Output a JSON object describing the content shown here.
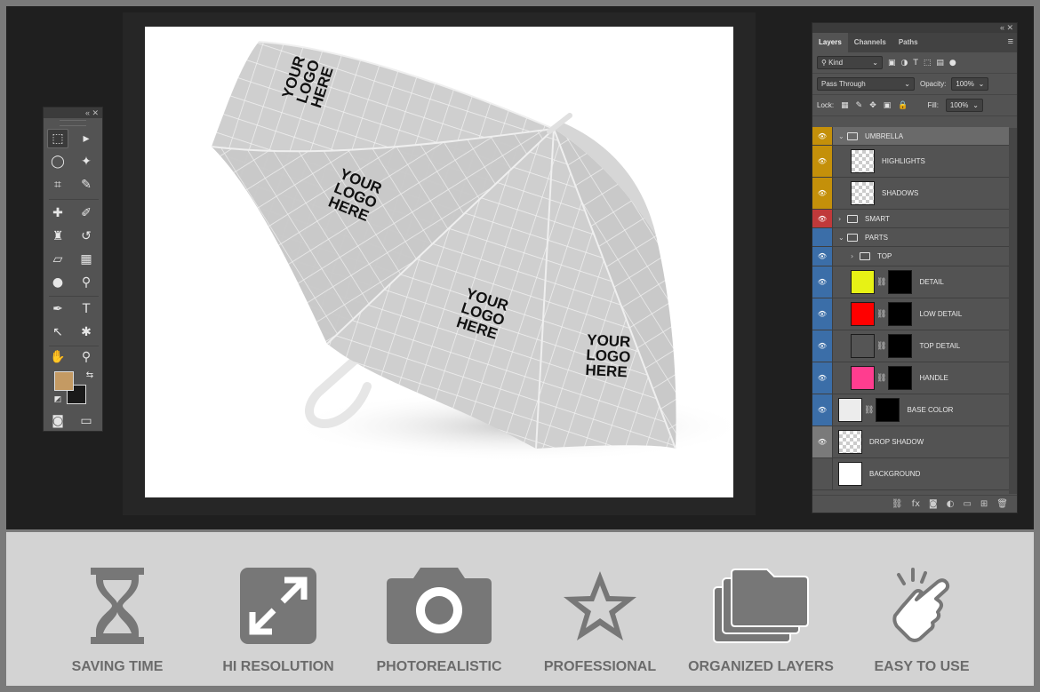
{
  "panels": {
    "tools_title_icons": "«  ✕",
    "layers_title_icons": "«  ✕"
  },
  "layers_panel": {
    "tabs": [
      "Layers",
      "Channels",
      "Paths"
    ],
    "filter_kind": "Kind",
    "blend_mode": "Pass Through",
    "opacity_label": "Opacity:",
    "opacity_value": "100%",
    "lock_label": "Lock:",
    "fill_label": "Fill:",
    "fill_value": "100%",
    "layers": [
      {
        "name": "UMBRELLA",
        "kind": "group",
        "open": true,
        "color": "#c4900a"
      },
      {
        "name": "HIGHLIGHTS",
        "kind": "layer",
        "color": "#c4900a"
      },
      {
        "name": "SHADOWS",
        "kind": "layer",
        "color": "#c4900a"
      },
      {
        "name": "SMART",
        "kind": "group",
        "open": false,
        "color": "#c0393a"
      },
      {
        "name": "PARTS",
        "kind": "group",
        "open": true,
        "color": "#3b6ea8"
      },
      {
        "name": "TOP",
        "kind": "group",
        "open": false,
        "color": "#3b6ea8"
      },
      {
        "name": "DETAIL",
        "kind": "fill",
        "swatch": "#e7f215",
        "color": "#3b6ea8"
      },
      {
        "name": "LOW DETAIL",
        "kind": "fill",
        "swatch": "#ff0000",
        "color": "#3b6ea8"
      },
      {
        "name": "TOP DETAIL",
        "kind": "fill",
        "swatch": "#555555",
        "color": "#3b6ea8"
      },
      {
        "name": "HANDLE",
        "kind": "fill",
        "swatch": "#ff3d8f",
        "color": "#3b6ea8"
      },
      {
        "name": "BASE COLOR",
        "kind": "fill",
        "swatch": "#ececec",
        "color": "#3b6ea8"
      },
      {
        "name": "DROP SHADOW",
        "kind": "layer",
        "color": "#7a7a7a"
      },
      {
        "name": "BACKGROUND",
        "kind": "layer",
        "color": "none"
      }
    ]
  },
  "artwork": {
    "logo_text": [
      "YOUR",
      "LOGO",
      "HERE"
    ],
    "canvas_color": "#cfcfcf"
  },
  "colors": {
    "foreground": "#c49a63",
    "background": "#1a1a1a"
  },
  "features": [
    {
      "label": "SAVING TIME",
      "icon": "hourglass-icon"
    },
    {
      "label": "HI RESOLUTION",
      "icon": "expand-arrows-icon"
    },
    {
      "label": "PHOTOREALISTIC",
      "icon": "camera-icon"
    },
    {
      "label": "PROFESSIONAL",
      "icon": "star-icon"
    },
    {
      "label": "ORGANIZED LAYERS",
      "icon": "folders-icon"
    },
    {
      "label": "EASY TO USE",
      "icon": "pointing-hand-icon"
    }
  ]
}
